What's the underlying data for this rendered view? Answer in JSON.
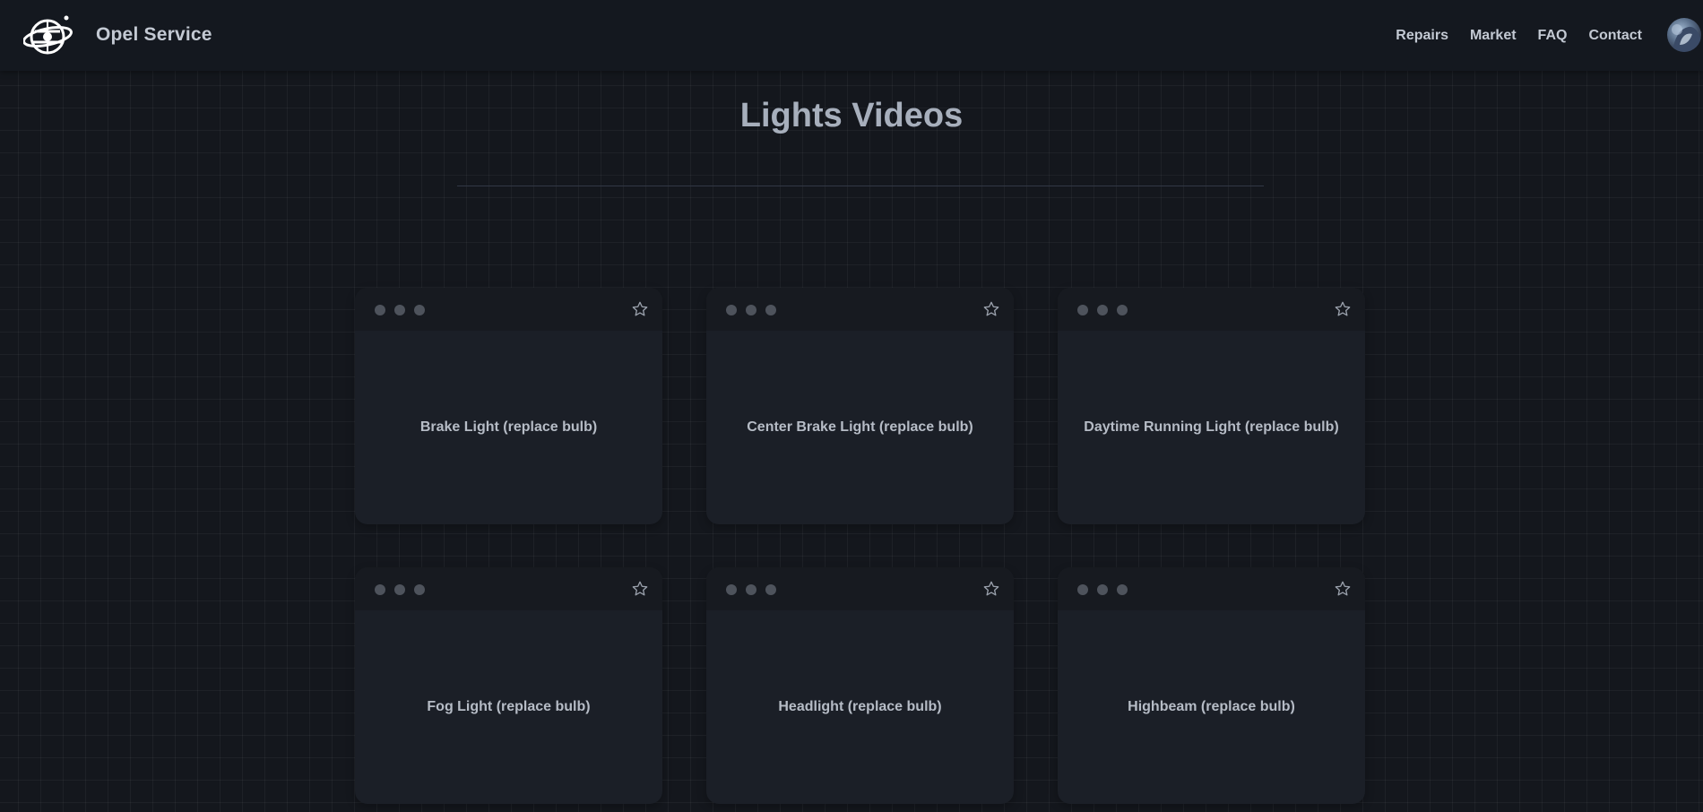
{
  "navbar": {
    "brand_name": "Opel Service",
    "links": [
      "Repairs",
      "Market",
      "FAQ",
      "Contact"
    ]
  },
  "page": {
    "title": "Lights Videos"
  },
  "cards": [
    {
      "title": "Brake Light (replace bulb)"
    },
    {
      "title": "Center Brake Light (replace bulb)"
    },
    {
      "title": "Daytime Running Light (replace bulb)"
    },
    {
      "title": "Fog Light (replace bulb)"
    },
    {
      "title": "Headlight (replace bulb)"
    },
    {
      "title": "Highbeam (replace bulb)"
    }
  ],
  "icons": {
    "brand": "globe-steering-wheel-logo",
    "favorite": "star-outline-icon",
    "window_controls": "dot-icon"
  },
  "colors": {
    "background": "#14171d",
    "navbar": "#14181f",
    "card": "#1b1f27",
    "card_header": "#171a20",
    "text": "#c3c9d3",
    "title": "#a7afbc",
    "dot": "#4e535c"
  }
}
